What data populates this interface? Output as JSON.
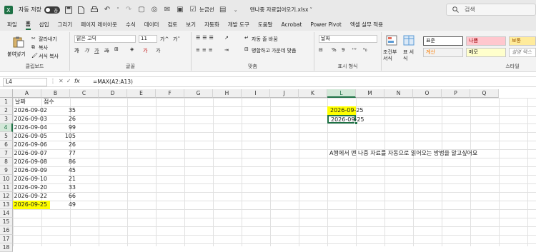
{
  "titlebar": {
    "autosave_label": "자동 저장",
    "toggle_state": "끔",
    "eye_label": "눈금선",
    "filename": "맨나중 자료읽어오기.xlsx",
    "search_placeholder": "검색"
  },
  "tabs": [
    "파일",
    "홈",
    "삽입",
    "그리기",
    "페이지 레이아웃",
    "수식",
    "데이터",
    "검토",
    "보기",
    "자동화",
    "개발 도구",
    "도움말",
    "Acrobat",
    "Power Pivot",
    "엑셀 실무 적용"
  ],
  "active_tab": "홈",
  "ribbon": {
    "clipboard": {
      "paste": "붙여넣기",
      "cut": "잘라내기",
      "copy": "복사",
      "format_painter": "서식 복사",
      "label": "클립보드"
    },
    "font": {
      "name": "맑은 고딕",
      "size": "11",
      "grow": "가^",
      "shrink": "가˅",
      "bold": "가",
      "italic": "가",
      "underline": "가",
      "strike": "가",
      "color_letter": "가",
      "fill_letter": "가",
      "label": "글꼴"
    },
    "alignment": {
      "wrap": "자동 줄 바꿈",
      "merge": "병합하고 가운데 맞춤",
      "label": "맞춤"
    },
    "number": {
      "format": "날짜",
      "label": "표시 형식"
    },
    "styles": {
      "cond": "조건부 서식",
      "table": "표 서식",
      "normal": "표준",
      "bad": "나쁨",
      "good": "보통",
      "calc": "계산",
      "note": "메모",
      "explain": "설명 텍스",
      "label": "스타일"
    }
  },
  "formula_bar": {
    "name_box": "L4",
    "fx": "fx",
    "formula": "=MAX(A2:A13)"
  },
  "columns": [
    "A",
    "B",
    "C",
    "D",
    "E",
    "F",
    "G",
    "H",
    "I",
    "J",
    "K",
    "L",
    "M",
    "N",
    "O",
    "P",
    "Q"
  ],
  "selected_column": "L",
  "rows": [
    "1",
    "2",
    "3",
    "4",
    "5",
    "6",
    "7",
    "8",
    "9",
    "10",
    "11",
    "12",
    "13",
    "14",
    "15",
    "16",
    "17",
    "18"
  ],
  "selected_row": "4",
  "table": {
    "header_a": "날짜",
    "header_b": "점수",
    "rows": [
      {
        "date": "2026-09-02",
        "score": "35"
      },
      {
        "date": "2026-09-03",
        "score": "26"
      },
      {
        "date": "2026-09-04",
        "score": "99"
      },
      {
        "date": "2026-09-05",
        "score": "105"
      },
      {
        "date": "2026-09-06",
        "score": "26"
      },
      {
        "date": "2026-09-07",
        "score": "77"
      },
      {
        "date": "2026-09-08",
        "score": "86"
      },
      {
        "date": "2026-09-09",
        "score": "45"
      },
      {
        "date": "2026-09-10",
        "score": "21"
      },
      {
        "date": "2026-09-20",
        "score": "33"
      },
      {
        "date": "2026-09-22",
        "score": "66"
      },
      {
        "date": "2026-09-25",
        "score": "49"
      }
    ]
  },
  "l2_value": "2026-09-25",
  "l4_value": "2026-09-25",
  "note_text": "A행에서 맨 나중 자료를 자동으로 읽어오는 방법을 알고싶어요",
  "colors": {
    "accent": "#1e7145",
    "highlight": "#ffff00"
  }
}
